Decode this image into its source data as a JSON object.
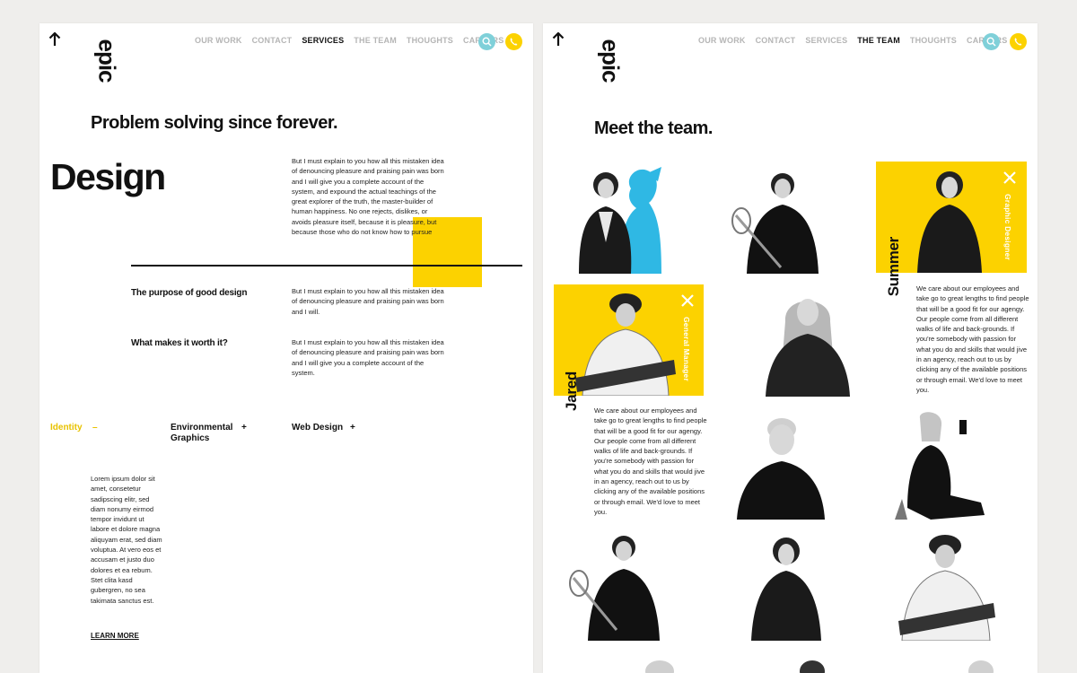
{
  "left": {
    "logo": "epic",
    "nav": [
      "OUR WORK",
      "CONTACT",
      "SERVICES",
      "THE TEAM",
      "THOUGHTS",
      "CAREERS"
    ],
    "nav_active_index": 2,
    "tagline": "Problem solving since forever.",
    "section_title": "Design",
    "intro": "But I must explain to you how all this mistaken idea of denouncing pleasure and praising pain was born and I will give you a complete account of the system, and expound the actual teachings of the great explorer of the truth, the master-builder of human happiness. No one rejects, dislikes, or avoids pleasure itself, because it is pleasure, but because those who do not know how to pursue",
    "purpose_heading": "The purpose of good design",
    "purpose_text": "But I must explain to you how all this mistaken idea of denouncing pleasure and praising pain was born and I will.",
    "worth_heading": "What makes it worth it?",
    "worth_text": "But I must explain to you how all this mistaken idea of denouncing pleasure and praising pain was born and I will give you a complete account of the system.",
    "services": [
      {
        "label": "Identity",
        "sign": "–"
      },
      {
        "label": "Environmental Graphics",
        "sign": "+"
      },
      {
        "label": "Web Design",
        "sign": "+"
      }
    ],
    "lorem": "Lorem ipsum dolor sit amet, consetetur sadipscing elitr, sed diam nonumy eirmod tempor invidunt ut labore et dolore magna aliquyam erat, sed diam voluptua. At vero eos et accusam et justo duo dolores et ea rebum. Stet clita kasd gubergren, no sea takimata sanctus est.",
    "learn_more": "LEARN MORE"
  },
  "right": {
    "logo": "epic",
    "nav": [
      "OUR WORK",
      "CONTACT",
      "SERVICES",
      "THE TEAM",
      "THOUGHTS",
      "CAREERS"
    ],
    "nav_active_index": 3,
    "heading": "Meet the team.",
    "jared": {
      "name": "Jared",
      "role": "General Manager"
    },
    "summer": {
      "name": "Summer",
      "role": "Graphic Designer"
    },
    "bio": "We care about our employees and take go to great lengths to find people that will be a good fit for our agengy. Our people come from all different walks of life and back-grounds. If you're somebody with passion for what you do and skills that would jive in an agency, reach out to us by clicking any of the available positions or through email. We'd love to meet you."
  },
  "colors": {
    "accent_yellow": "#fcd200",
    "accent_cyan": "#7fd0d9",
    "photo_blue": "#2fb8e4"
  },
  "icons": [
    "arrow-up-icon",
    "search-icon",
    "phone-icon",
    "close-icon"
  ]
}
